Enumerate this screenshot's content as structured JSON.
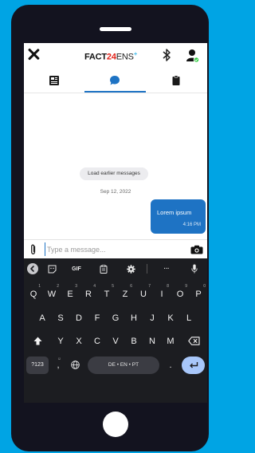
{
  "header": {
    "logo_part1": "FACT",
    "logo_part2": "24",
    "logo_part3": "ENS",
    "logo_plus": "+"
  },
  "tabs": [
    {
      "icon": "news-icon",
      "active": false
    },
    {
      "icon": "chat-icon",
      "active": true
    },
    {
      "icon": "clipboard-icon",
      "active": false
    }
  ],
  "chat": {
    "load_earlier": "Load earlier messages",
    "date": "Sep 12, 2022",
    "message_text": "Lorem ipsum",
    "message_time": "4:16 PM"
  },
  "composer": {
    "placeholder": "Type a message..."
  },
  "keyboard": {
    "toolbar": {
      "gif": "GIF",
      "more": "···"
    },
    "row1": [
      {
        "label": "Q",
        "hint": "1"
      },
      {
        "label": "W",
        "hint": "2"
      },
      {
        "label": "E",
        "hint": "3"
      },
      {
        "label": "R",
        "hint": "4"
      },
      {
        "label": "T",
        "hint": "5"
      },
      {
        "label": "Z",
        "hint": "6"
      },
      {
        "label": "U",
        "hint": "7"
      },
      {
        "label": "I",
        "hint": "8"
      },
      {
        "label": "O",
        "hint": "9"
      },
      {
        "label": "P",
        "hint": "0"
      }
    ],
    "row2": [
      "A",
      "S",
      "D",
      "F",
      "G",
      "H",
      "J",
      "K",
      "L"
    ],
    "row3": [
      "Y",
      "X",
      "C",
      "V",
      "B",
      "N",
      "M"
    ],
    "row4": {
      "symbols": "?123",
      "comma": ",",
      "emoji_hint": "☺",
      "space": "DE • EN • PT",
      "period": "."
    }
  },
  "colors": {
    "accent_blue": "#1e73c4",
    "logo_red": "#e2231a",
    "background": "#00a4e4",
    "online_green": "#2ecc40"
  }
}
